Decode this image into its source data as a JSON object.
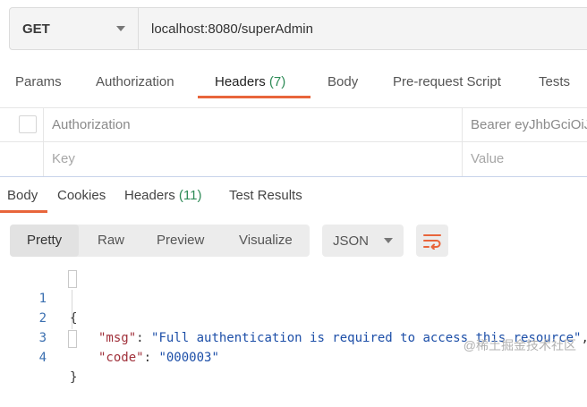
{
  "request": {
    "method": "GET",
    "url": "localhost:8080/superAdmin"
  },
  "request_tabs": [
    {
      "label": "Params"
    },
    {
      "label": "Authorization"
    },
    {
      "label": "Headers",
      "count": "(7)"
    },
    {
      "label": "Body"
    },
    {
      "label": "Pre-request Script"
    },
    {
      "label": "Tests"
    }
  ],
  "headers_table": {
    "rows": [
      {
        "key": "Authorization",
        "value": "Bearer eyJhbGciOiJ"
      },
      {
        "key_placeholder": "Key",
        "value_placeholder": "Value"
      }
    ]
  },
  "response_tabs": [
    {
      "label": "Body"
    },
    {
      "label": "Cookies"
    },
    {
      "label": "Headers",
      "count": "(11)"
    },
    {
      "label": "Test Results"
    }
  ],
  "toolbar": {
    "views": [
      "Pretty",
      "Raw",
      "Preview",
      "Visualize"
    ],
    "format": "JSON"
  },
  "response_body": {
    "line_numbers": [
      "1",
      "2",
      "3",
      "4"
    ],
    "open_brace": "{",
    "close_brace": "}",
    "entries": [
      {
        "key": "\"msg\"",
        "value": "\"Full authentication is required to access this resource\"",
        "trail": ","
      },
      {
        "key": "\"code\"",
        "value": "\"000003\"",
        "trail": ""
      }
    ]
  },
  "watermark": "@稀土掘金技术社区",
  "colors": {
    "accent": "#e8653b",
    "count_green": "#2e8b57",
    "json_key": "#a0303a",
    "json_string": "#1d4fa8"
  }
}
